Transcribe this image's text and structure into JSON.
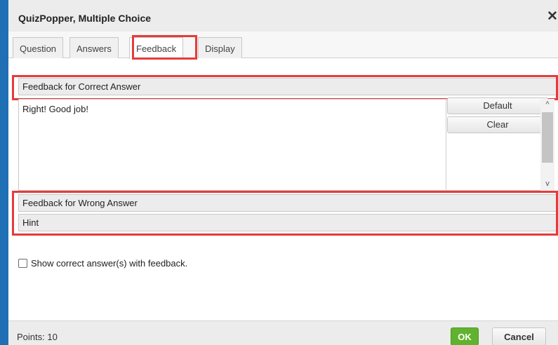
{
  "dialog": {
    "title": "QuizPopper, Multiple Choice",
    "close_icon": "close-icon",
    "close_glyph": "✕"
  },
  "tabs": [
    {
      "label": "Question",
      "active": false
    },
    {
      "label": "Answers",
      "active": false
    },
    {
      "label": "Feedback",
      "active": true
    },
    {
      "label": "Display",
      "active": false
    }
  ],
  "sections": {
    "correct": {
      "header": "Feedback for Correct Answer",
      "text": "Right! Good job!",
      "default_label": "Default",
      "clear_label": "Clear"
    },
    "wrong": {
      "header": "Feedback for Wrong Answer"
    },
    "hint": {
      "header": "Hint"
    }
  },
  "scrollbar": {
    "up_glyph": "^",
    "down_glyph": "v"
  },
  "options": {
    "show_correct_label": "Show correct answer(s) with feedback.",
    "show_correct_checked": false
  },
  "footer": {
    "points": "Points: 10",
    "ok_label": "OK",
    "cancel_label": "Cancel"
  },
  "colors": {
    "highlight": "#e53b3b",
    "ok_green": "#61b32f",
    "accent_blue": "#1f6fb5"
  }
}
